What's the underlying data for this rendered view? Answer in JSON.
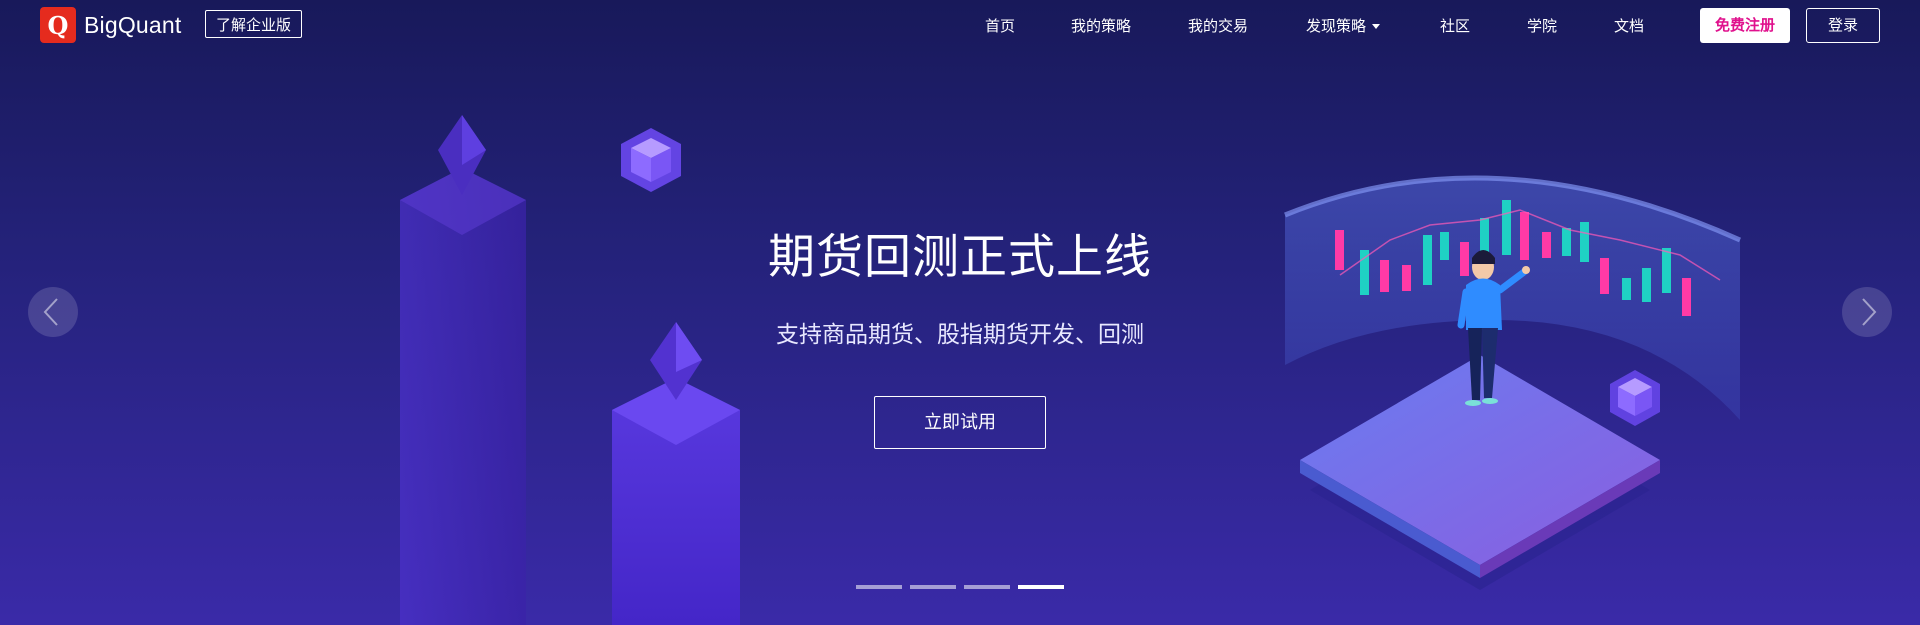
{
  "brand": {
    "logo_letter": "Q",
    "name": "BigQuant",
    "enterprise_label": "了解企业版"
  },
  "nav": {
    "items": [
      {
        "label": "首页"
      },
      {
        "label": "我的策略"
      },
      {
        "label": "我的交易"
      },
      {
        "label": "发现策略",
        "has_dropdown": true
      },
      {
        "label": "社区"
      },
      {
        "label": "学院"
      },
      {
        "label": "文档"
      }
    ],
    "register_label": "免费注册",
    "login_label": "登录"
  },
  "hero": {
    "title": "期货回测正式上线",
    "subtitle": "支持商品期货、股指期货开发、回测",
    "cta_label": "立即试用"
  },
  "carousel": {
    "slide_count": 4,
    "active_slide": 4,
    "prev_icon": "chevron-left-icon",
    "next_icon": "chevron-right-icon"
  },
  "colors": {
    "logo_red": "#e52b1e",
    "register_text": "#e0118d",
    "bg_top": "#18195a",
    "bg_bottom": "#3a2aa8"
  }
}
